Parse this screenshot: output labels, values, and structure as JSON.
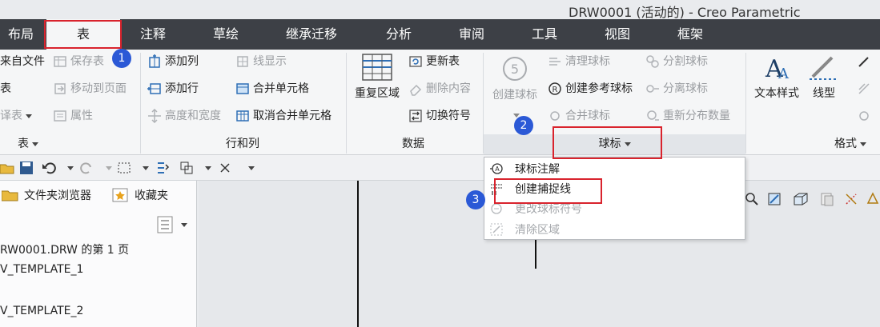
{
  "window": {
    "title": "DRW0001 (活动的) - Creo Parametric"
  },
  "menubar": {
    "tabs": [
      "布局",
      "表",
      "注释",
      "草绘",
      "继承迁移",
      "分析",
      "审阅",
      "工具",
      "视图",
      "框架"
    ],
    "active_tab": "表"
  },
  "ribbon": {
    "table_group": {
      "items": [
        "来自文件",
        "保存表",
        "表",
        "移动到页面",
        "译表",
        "属性"
      ],
      "label": "表"
    },
    "rows_cols_group": {
      "items": [
        "添加列",
        "线显示",
        "添加行",
        "合并单元格",
        "高度和宽度",
        "取消合并单元格"
      ],
      "label": "行和列"
    },
    "data_group": {
      "big_button": "重复区域",
      "items": [
        "更新表",
        "删除内容",
        "切换符号"
      ],
      "label": "数据"
    },
    "balloon_group": {
      "big_button": "创建球标",
      "items": [
        "清理球标",
        "分割球标",
        "创建参考球标",
        "分离球标",
        "合并球标",
        "重新分布数量"
      ],
      "label": "球标"
    },
    "format_group": {
      "big_buttons": [
        "文本样式",
        "线型"
      ],
      "label": "格式"
    }
  },
  "dropdown": {
    "items": [
      {
        "label": "球标注解",
        "enabled": true
      },
      {
        "label": "创建捕捉线",
        "enabled": true
      },
      {
        "label": "更改球标符号",
        "enabled": false
      },
      {
        "label": "清除区域",
        "enabled": false
      }
    ]
  },
  "left_panel": {
    "tabs": [
      "文件夹浏览器",
      "收藏夹"
    ],
    "tree": [
      "RW0001.DRW 的第 1 页",
      "V_TEMPLATE_1",
      "V_TEMPLATE_2"
    ]
  },
  "annotations": {
    "badges": [
      "1",
      "2",
      "3"
    ]
  },
  "colors": {
    "menubar": "#3d4046",
    "highlight": "#d9232d",
    "badge": "#2b59d6",
    "ribbon": "#f5f6f7"
  }
}
